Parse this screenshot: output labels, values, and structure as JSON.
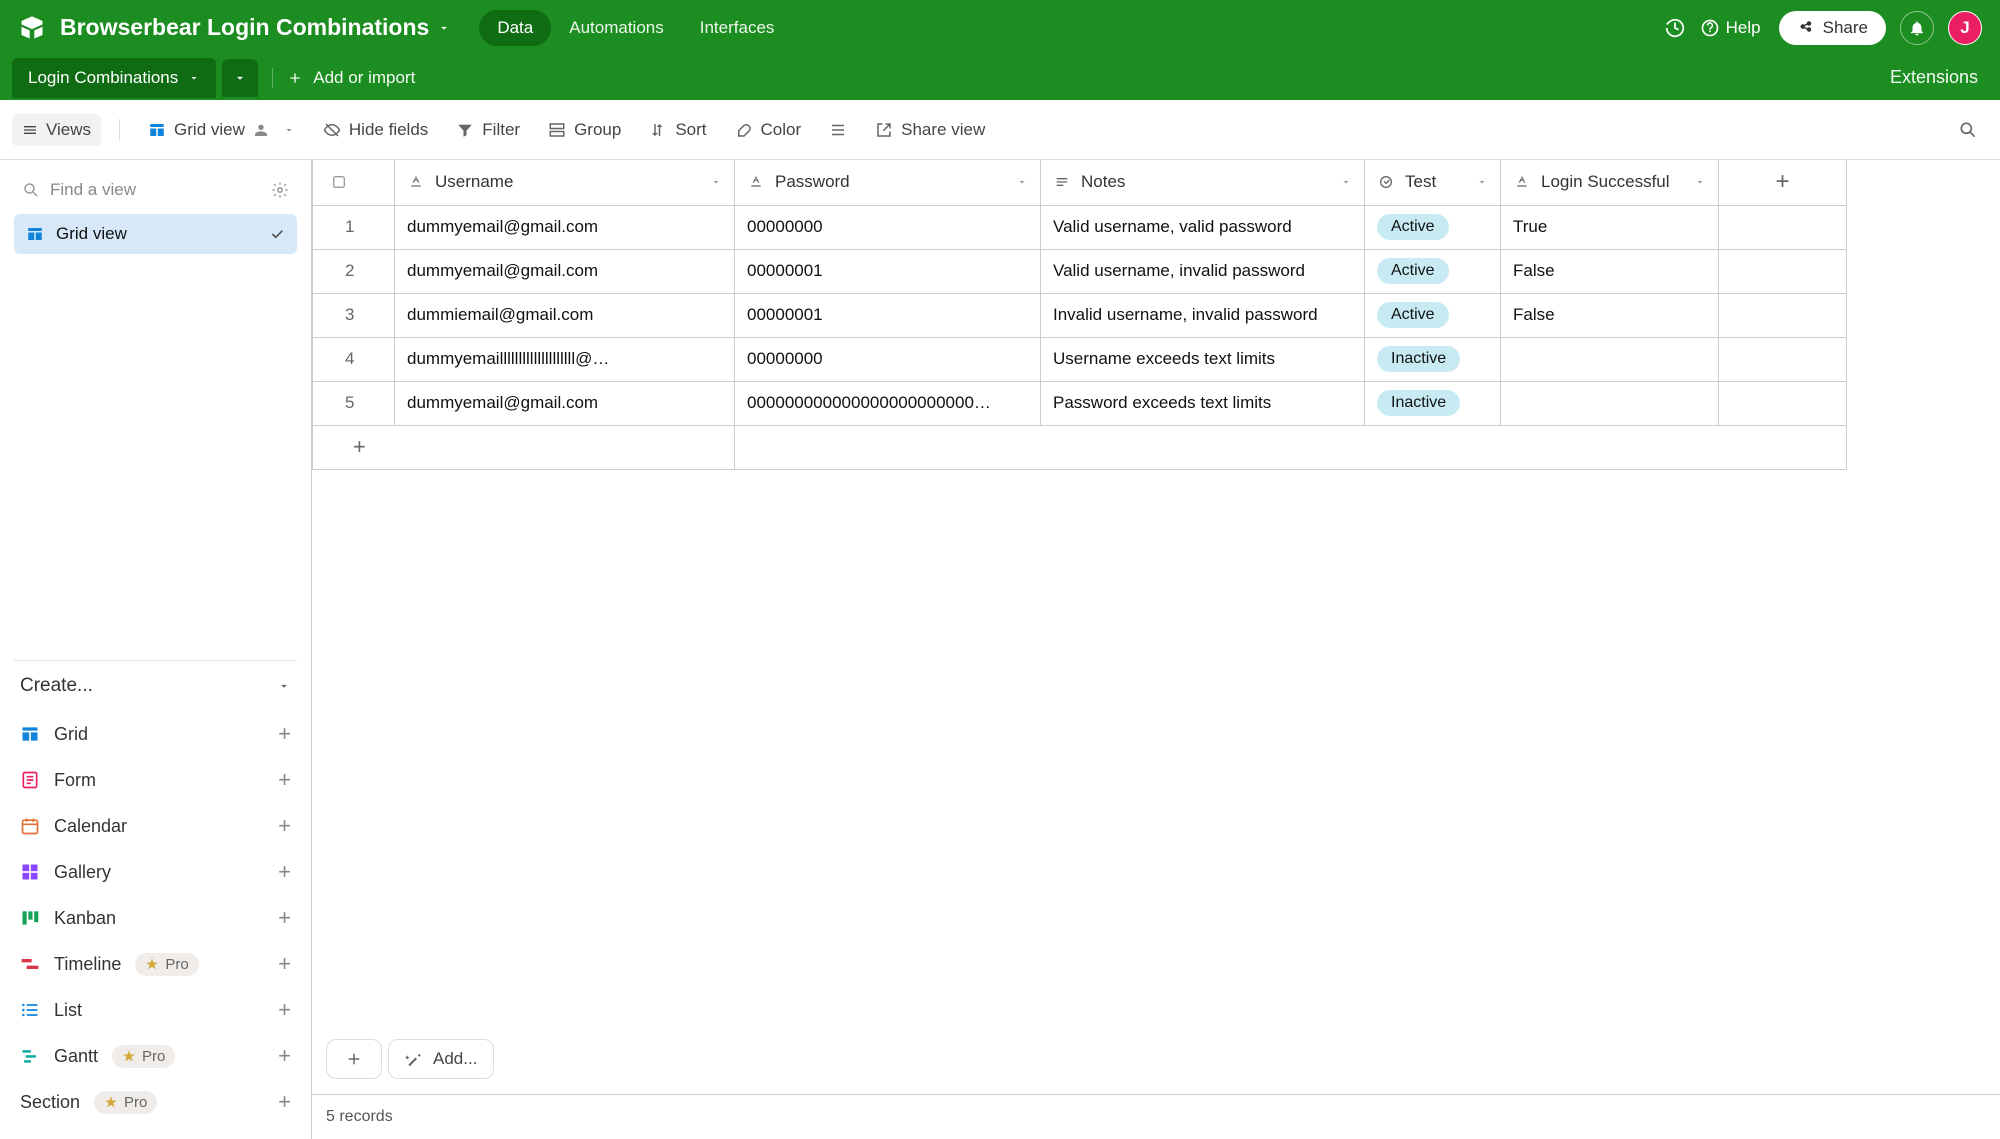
{
  "header": {
    "base_name": "Browserbear Login Combinations",
    "tabs": {
      "data": "Data",
      "automations": "Automations",
      "interfaces": "Interfaces"
    },
    "help": "Help",
    "share": "Share",
    "avatar_letter": "J"
  },
  "subheader": {
    "table_name": "Login Combinations",
    "add_or_import": "Add or import",
    "extensions": "Extensions"
  },
  "toolbar": {
    "views": "Views",
    "grid_view": "Grid view",
    "hide_fields": "Hide fields",
    "filter": "Filter",
    "group": "Group",
    "sort": "Sort",
    "color": "Color",
    "share_view": "Share view"
  },
  "sidebar": {
    "search_placeholder": "Find a view",
    "grid_view": "Grid view",
    "create": "Create...",
    "types": {
      "grid": "Grid",
      "form": "Form",
      "calendar": "Calendar",
      "gallery": "Gallery",
      "kanban": "Kanban",
      "timeline": "Timeline",
      "list": "List",
      "gantt": "Gantt",
      "section": "Section"
    },
    "pro": "Pro"
  },
  "columns": {
    "username": "Username",
    "password": "Password",
    "notes": "Notes",
    "test": "Test",
    "login_successful": "Login Successful"
  },
  "rows": [
    {
      "n": "1",
      "username": "dummyemail@gmail.com",
      "password": "00000000",
      "notes": "Valid username, valid password",
      "test": "Active",
      "login": "True"
    },
    {
      "n": "2",
      "username": "dummyemail@gmail.com",
      "password": "00000001",
      "notes": "Valid username, invalid password",
      "test": "Active",
      "login": "False"
    },
    {
      "n": "3",
      "username": "dummiemail@gmail.com",
      "password": "00000001",
      "notes": "Invalid username, invalid password",
      "test": "Active",
      "login": "False"
    },
    {
      "n": "4",
      "username": "dummyemaillllllllllllllllllll@…",
      "password": "00000000",
      "notes": "Username exceeds text limits",
      "test": "Inactive",
      "login": ""
    },
    {
      "n": "5",
      "username": "dummyemail@gmail.com",
      "password": "000000000000000000000000…",
      "notes": "Password exceeds text limits",
      "test": "Inactive",
      "login": ""
    }
  ],
  "footer": {
    "add_btn": "Add...",
    "records": "5 records"
  }
}
